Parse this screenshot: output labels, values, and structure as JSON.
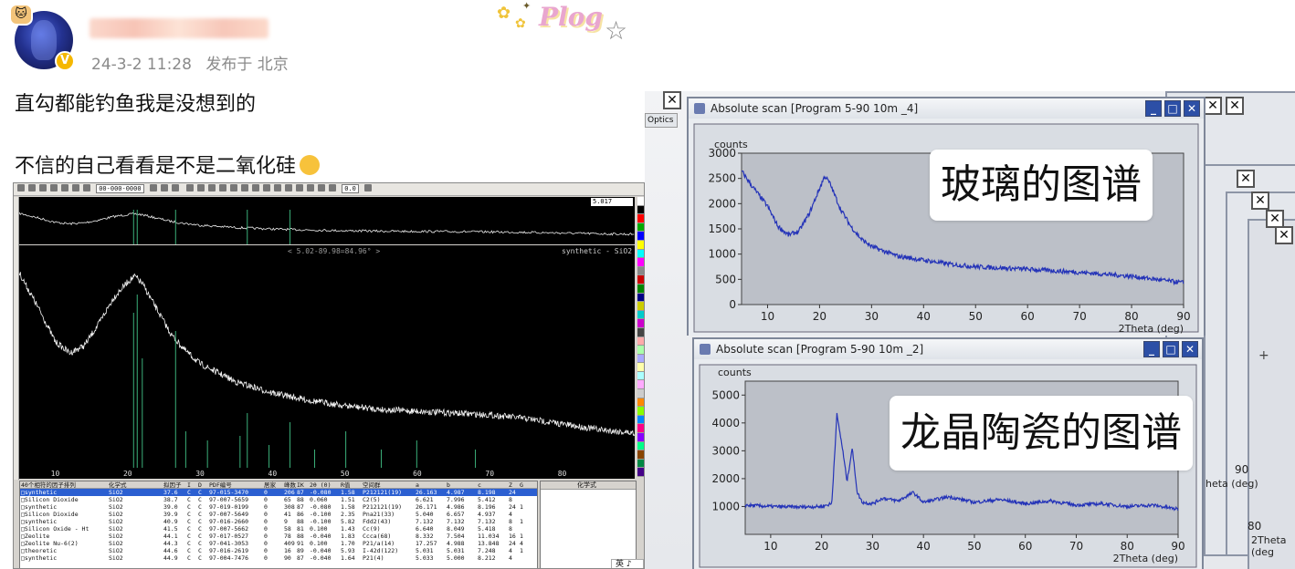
{
  "post": {
    "timestamp": "24-3-2 11:28",
    "location": "发布于 北京",
    "sticker_text": "Plog",
    "line1": "直勾都能钓鱼我是没想到的",
    "line2": "不信的自己看看是不是二氧化硅"
  },
  "software": {
    "pdf_field": "00-000-0000",
    "zoom_value": "5.017",
    "value_field": "0.0",
    "range_label": "< 5.02-89.98=84.96° >",
    "series_label": "synthetic - SiO2",
    "x_ticks": [
      "10",
      "20",
      "30",
      "40",
      "50",
      "60",
      "70",
      "80"
    ],
    "table": {
      "headers": [
        "40个相符的因子排列",
        "化学式",
        "拟因子",
        "I",
        "D",
        "PDF编号",
        "居家",
        "峰数",
        "IK",
        "2θ (0)",
        "R值",
        "空间群",
        "a",
        "b",
        "c",
        "Z",
        "G"
      ],
      "rows": [
        [
          "synthetic",
          "SiO2",
          "37.6",
          "C",
          "C",
          "97-015-3470",
          "0",
          "206",
          "87",
          "-0.080",
          "1.58",
          "P212121(19)",
          "26.163",
          "4.987",
          "8.198",
          "24",
          ""
        ],
        [
          "Silicon Dioxide",
          "SiO2",
          "38.7",
          "C",
          "C",
          "97-007-5659",
          "0",
          "65",
          "88",
          "0.060",
          "1.51",
          "C2(5)",
          "6.621",
          "7.996",
          "5.412",
          "8",
          ""
        ],
        [
          "synthetic",
          "SiO2",
          "39.0",
          "C",
          "C",
          "97-019-0199",
          "0",
          "308",
          "87",
          "-0.080",
          "1.58",
          "P212121(19)",
          "26.171",
          "4.986",
          "8.196",
          "24",
          "1"
        ],
        [
          "Silicon Dioxide",
          "SiO2",
          "39.9",
          "C",
          "C",
          "97-007-5649",
          "0",
          "41",
          "86",
          "-0.100",
          "2.35",
          "Pna21(33)",
          "5.040",
          "6.657",
          "4.937",
          "4",
          ""
        ],
        [
          "synthetic",
          "SiO2",
          "40.9",
          "C",
          "C",
          "97-016-2660",
          "0",
          "9",
          "88",
          "-0.100",
          "5.82",
          "Fdd2(43)",
          "7.132",
          "7.132",
          "7.132",
          "8",
          "1"
        ],
        [
          "Silicon Oxide - Ht",
          "SiO2",
          "41.5",
          "C",
          "C",
          "97-007-5662",
          "0",
          "58",
          "81",
          "0.100",
          "1.43",
          "Cc(9)",
          "6.640",
          "8.049",
          "5.418",
          "8",
          ""
        ],
        [
          "Zeolite",
          "SiO2",
          "44.1",
          "C",
          "C",
          "97-017-0527",
          "0",
          "78",
          "88",
          "-0.040",
          "1.83",
          "Ccca(68)",
          "8.332",
          "7.504",
          "11.034",
          "16",
          "1"
        ],
        [
          "Zeolite Nu-6(2)",
          "SiO2",
          "44.3",
          "C",
          "C",
          "97-041-3053",
          "0",
          "409",
          "91",
          "0.100",
          "1.70",
          "P21/a(14)",
          "17.257",
          "4.988",
          "13.848",
          "24",
          "4"
        ],
        [
          "theoretic",
          "SiO2",
          "44.6",
          "C",
          "C",
          "97-016-2619",
          "0",
          "16",
          "89",
          "-0.040",
          "5.93",
          "I-42d(122)",
          "5.031",
          "5.031",
          "7.248",
          "4",
          "1"
        ],
        [
          "synthetic",
          "SiO2",
          "44.9",
          "C",
          "C",
          "97-004-7476",
          "0",
          "90",
          "87",
          "-0.040",
          "1.64",
          "P21(4)",
          "5.033",
          "5.000",
          "8.212",
          "4",
          ""
        ]
      ]
    },
    "right_panel_header": "化学式",
    "ime_text": "英 ♪"
  },
  "photo": {
    "window1_title": "Absolute scan [Program 5-90 10m _4]",
    "window2_title": "Absolute scan [Program 5-90 10m _2]",
    "toolbar_label": "Optics",
    "y_label": "counts",
    "x_label": "2Theta (deg)",
    "plot1_yticks": [
      "3000",
      "2500",
      "2000",
      "1500",
      "1000",
      "500",
      "0"
    ],
    "plot2_yticks": [
      "5000",
      "4000",
      "3000",
      "2000",
      "1000"
    ],
    "xticks": [
      "10",
      "20",
      "30",
      "40",
      "50",
      "60",
      "70",
      "80",
      "90"
    ],
    "label_glass": "玻璃的图谱",
    "label_ceramic": "龙晶陶瓷的图谱",
    "peek_tick1": "90",
    "peek_label1": "heta (deg)",
    "peek_tick2": "80",
    "peek_label2": "2Theta (deg"
  },
  "chart_data": [
    {
      "type": "line",
      "title": "",
      "xlabel": "",
      "ylabel": "",
      "x_ticks": [
        10,
        20,
        30,
        40,
        50,
        60,
        70,
        80
      ],
      "series": [
        {
          "name": "synthetic - SiO2",
          "x": [
            5,
            8,
            10,
            12,
            14,
            16,
            18,
            20,
            21,
            22,
            24,
            26,
            28,
            30,
            35,
            40,
            45,
            50,
            55,
            60,
            65,
            70,
            75,
            80,
            85,
            90
          ],
          "y": [
            1.0,
            0.78,
            0.62,
            0.56,
            0.6,
            0.72,
            0.86,
            0.95,
            0.98,
            0.94,
            0.8,
            0.66,
            0.57,
            0.5,
            0.4,
            0.34,
            0.3,
            0.27,
            0.25,
            0.24,
            0.23,
            0.22,
            0.2,
            0.17,
            0.14,
            0.12
          ]
        }
      ]
    },
    {
      "type": "line",
      "title": "",
      "xlabel": "2Theta (deg)",
      "ylabel": "counts",
      "ylim": [
        0,
        3000
      ],
      "xlim": [
        5,
        90
      ],
      "series": [
        {
          "name": "",
          "x": [
            5,
            7,
            10,
            12,
            14,
            16,
            18,
            20,
            21,
            22,
            24,
            26,
            28,
            30,
            35,
            40,
            45,
            50,
            60,
            70,
            80,
            90
          ],
          "y": [
            2650,
            2350,
            1950,
            1550,
            1380,
            1450,
            1800,
            2300,
            2550,
            2400,
            1900,
            1550,
            1300,
            1150,
            960,
            880,
            800,
            750,
            700,
            640,
            560,
            430
          ]
        }
      ]
    },
    {
      "type": "line",
      "title": "",
      "xlabel": "2Theta (deg)",
      "ylabel": "counts",
      "ylim": [
        0,
        5500
      ],
      "xlim": [
        5,
        90
      ],
      "series": [
        {
          "name": "",
          "x": [
            5,
            10,
            15,
            20,
            22,
            23,
            24,
            25,
            26,
            27,
            28,
            30,
            32,
            35,
            38,
            40,
            45,
            50,
            55,
            60,
            65,
            70,
            75,
            80,
            85,
            90
          ],
          "y": [
            1050,
            1000,
            980,
            1000,
            1100,
            4300,
            3200,
            1900,
            3100,
            1500,
            1150,
            1100,
            1300,
            1200,
            1500,
            1150,
            1350,
            1150,
            1250,
            1100,
            1200,
            1050,
            1100,
            1000,
            1050,
            900
          ]
        }
      ]
    }
  ]
}
